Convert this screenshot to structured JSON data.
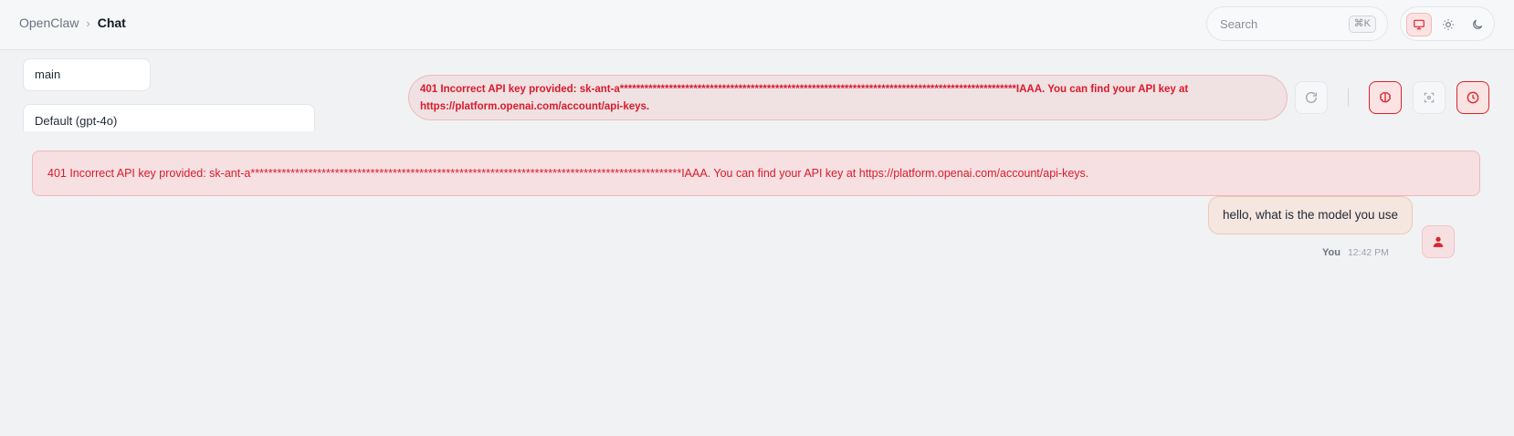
{
  "header": {
    "breadcrumb_root": "OpenClaw",
    "breadcrumb_separator": "›",
    "breadcrumb_current": "Chat",
    "search_placeholder": "Search",
    "search_shortcut": "⌘K",
    "theme_options": [
      "system",
      "light",
      "dark"
    ],
    "active_theme": "system"
  },
  "selectors": {
    "session": "main",
    "model": "Default (gpt-4o)"
  },
  "error_message": "401 Incorrect API key provided: sk-ant-a*************************************************************************************************IAAA. You can find your API key at https://platform.openai.com/account/api-keys.",
  "banner_message": "401 Incorrect API key provided: sk-ant-a*************************************************************************************************IAAA. You can find your API key at https://platform.openai.com/account/api-keys.",
  "toolbar": {
    "icons": [
      "refresh-icon",
      "brain-icon",
      "focus-icon",
      "clock-icon"
    ]
  },
  "messages": [
    {
      "author": "You",
      "time": "12:42 PM",
      "text": "hello, what is the model you use"
    }
  ],
  "colors": {
    "accent": "#d81b2b",
    "error_bg": "#f6e0e2",
    "bubble_bg": "#f5e6df"
  }
}
